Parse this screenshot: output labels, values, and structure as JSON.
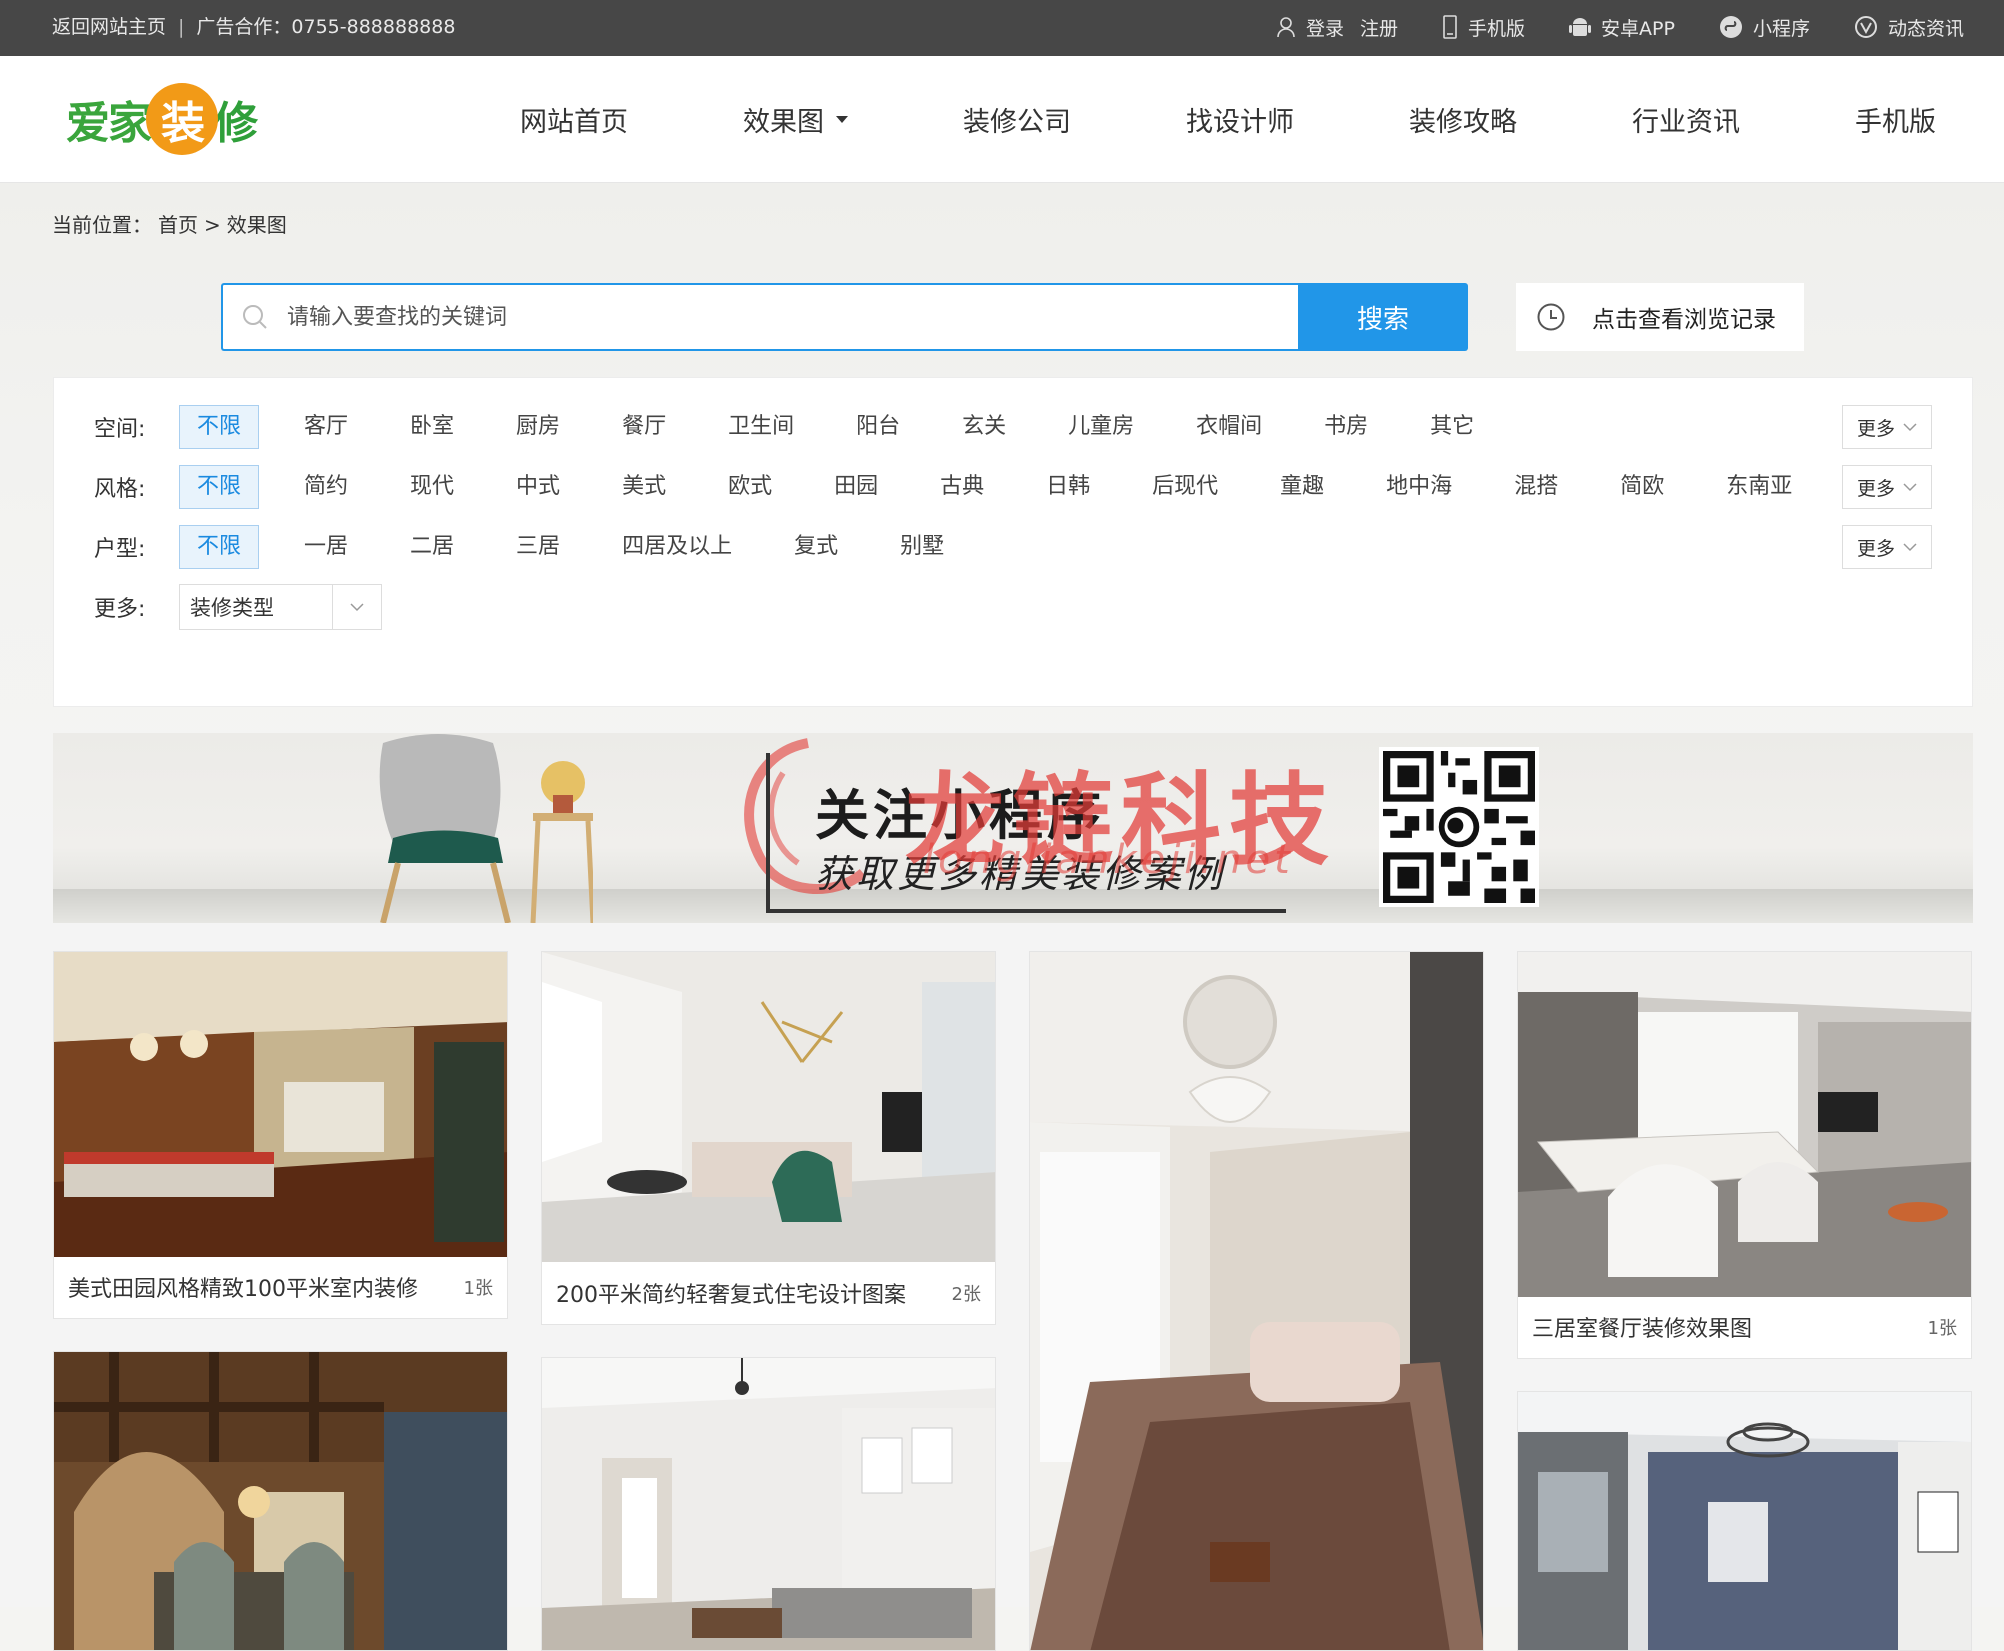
{
  "topbar": {
    "home_link": "返回网站主页",
    "separator": "|",
    "ad_text": "广告合作：0755-888888888",
    "login": "登录",
    "register": "注册",
    "mobile": "手机版",
    "android": "安卓APP",
    "miniprogram": "小程序",
    "news": "动态资讯"
  },
  "header": {
    "logo": {
      "part1": "爱家",
      "part2": "装",
      "part3": "修"
    },
    "nav": [
      "网站首页",
      "效果图",
      "装修公司",
      "找设计师",
      "装修攻略",
      "行业资讯",
      "手机版"
    ]
  },
  "breadcrumb": {
    "prefix": "当前位置：",
    "home": "首页",
    "sep": ">",
    "current": "效果图"
  },
  "search": {
    "placeholder": "请输入要查找的关键词",
    "button": "搜索",
    "history": "点击查看浏览记录"
  },
  "filters": {
    "space": {
      "label": "空间:",
      "options": [
        "不限",
        "客厅",
        "卧室",
        "厨房",
        "餐厅",
        "卫生间",
        "阳台",
        "玄关",
        "儿童房",
        "衣帽间",
        "书房",
        "其它"
      ],
      "more": "更多"
    },
    "style": {
      "label": "风格:",
      "options": [
        "不限",
        "简约",
        "现代",
        "中式",
        "美式",
        "欧式",
        "田园",
        "古典",
        "日韩",
        "后现代",
        "童趣",
        "地中海",
        "混搭",
        "简欧",
        "东南亚"
      ],
      "more": "更多"
    },
    "layout": {
      "label": "户型:",
      "options": [
        "不限",
        "一居",
        "二居",
        "三居",
        "四居及以上",
        "复式",
        "别墅"
      ],
      "more": "更多"
    },
    "extra": {
      "label": "更多:",
      "select": "装修类型"
    }
  },
  "banner": {
    "title": "关注小程序",
    "subtitle": "获取更多精美装修案例",
    "watermark": "龙链科技",
    "watermark_url": "longliankeji.net"
  },
  "cards": [
    {
      "title": "美式田园风格精致100平米室内装修",
      "count": "1张"
    },
    {
      "title": "200平米简约轻奢复式住宅设计图案",
      "count": "2张"
    },
    {
      "title": "",
      "count": ""
    },
    {
      "title": "三居室餐厅装修效果图",
      "count": "1张"
    },
    {
      "title": "",
      "count": ""
    },
    {
      "title": "",
      "count": ""
    },
    {
      "title": "",
      "count": ""
    }
  ],
  "colors": {
    "accent": "#2196e8",
    "topbar": "#474747",
    "logo_green": "#3aa53c",
    "logo_orange": "#f29a17"
  }
}
